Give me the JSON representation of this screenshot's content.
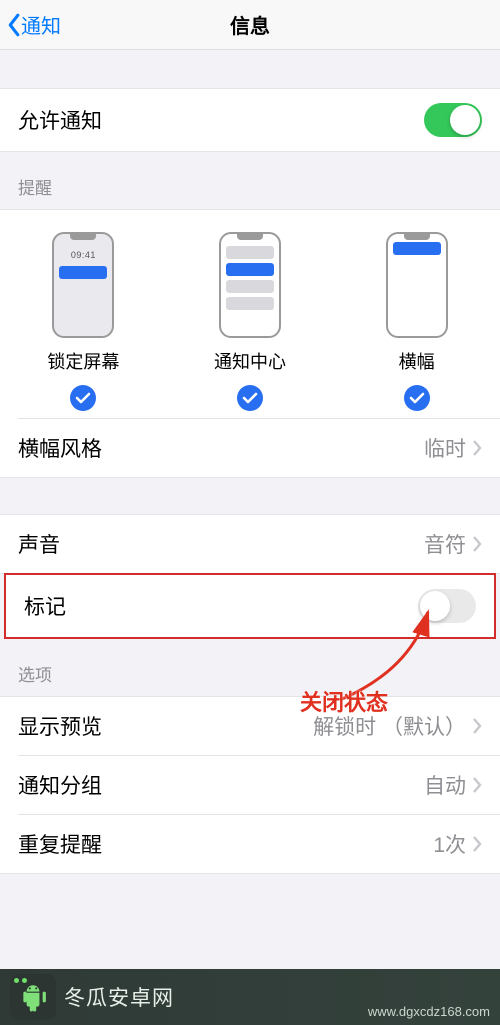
{
  "nav": {
    "back": "通知",
    "title": "信息"
  },
  "allow": {
    "label": "允许通知",
    "on": true
  },
  "alerts": {
    "header": "提醒",
    "lockTime": "09:41",
    "options": [
      {
        "label": "锁定屏幕",
        "checked": true
      },
      {
        "label": "通知中心",
        "checked": true
      },
      {
        "label": "横幅",
        "checked": true
      }
    ],
    "bannerStyle": {
      "label": "横幅风格",
      "value": "临时"
    }
  },
  "sound": {
    "label": "声音",
    "value": "音符"
  },
  "badge": {
    "label": "标记",
    "on": false
  },
  "optionsHeader": "选项",
  "options": {
    "preview": {
      "label": "显示预览",
      "value": "解锁时 （默认）"
    },
    "grouping": {
      "label": "通知分组",
      "value": "自动"
    },
    "repeat": {
      "label": "重复提醒",
      "value": "1次"
    }
  },
  "annotation": {
    "text": "关闭状态"
  },
  "footer": {
    "brand": "冬瓜安卓网",
    "url": "www.dgxcdz168.com"
  }
}
